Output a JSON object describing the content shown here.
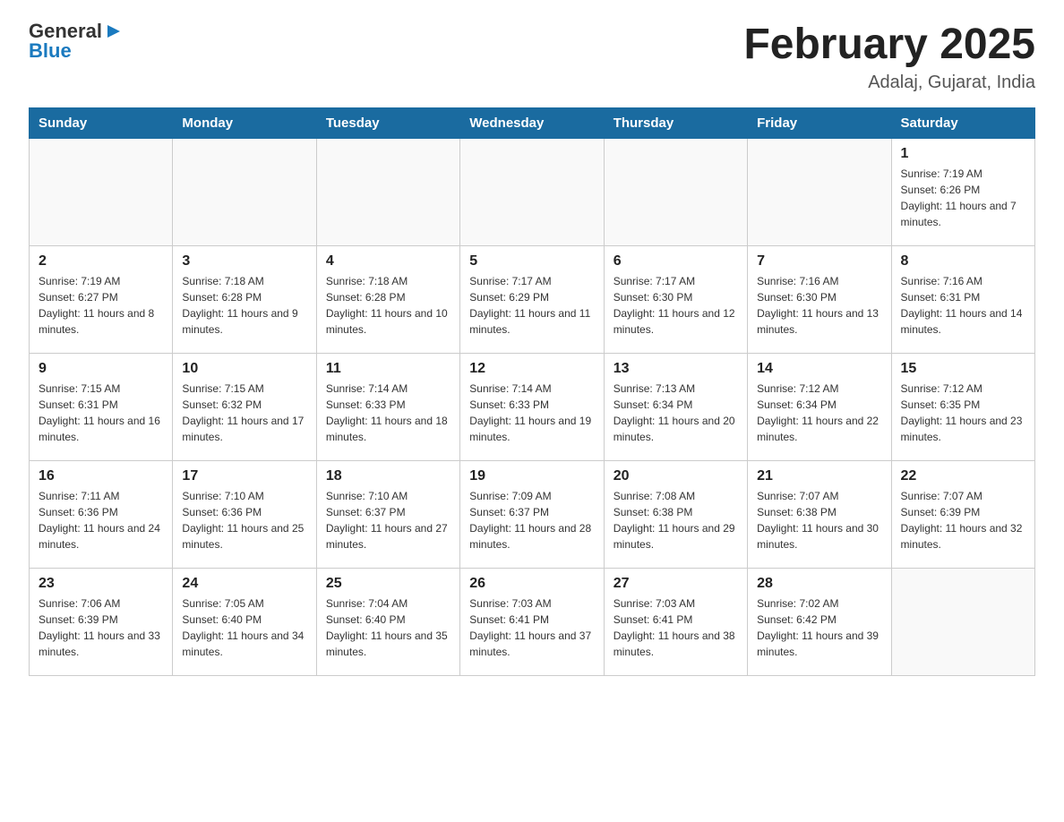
{
  "logo": {
    "text_general": "General",
    "text_blue": "Blue",
    "triangle": "▶"
  },
  "title": "February 2025",
  "subtitle": "Adalaj, Gujarat, India",
  "days_of_week": [
    "Sunday",
    "Monday",
    "Tuesday",
    "Wednesday",
    "Thursday",
    "Friday",
    "Saturday"
  ],
  "weeks": [
    [
      {
        "day": "",
        "sunrise": "",
        "sunset": "",
        "daylight": ""
      },
      {
        "day": "",
        "sunrise": "",
        "sunset": "",
        "daylight": ""
      },
      {
        "day": "",
        "sunrise": "",
        "sunset": "",
        "daylight": ""
      },
      {
        "day": "",
        "sunrise": "",
        "sunset": "",
        "daylight": ""
      },
      {
        "day": "",
        "sunrise": "",
        "sunset": "",
        "daylight": ""
      },
      {
        "day": "",
        "sunrise": "",
        "sunset": "",
        "daylight": ""
      },
      {
        "day": "1",
        "sunrise": "Sunrise: 7:19 AM",
        "sunset": "Sunset: 6:26 PM",
        "daylight": "Daylight: 11 hours and 7 minutes."
      }
    ],
    [
      {
        "day": "2",
        "sunrise": "Sunrise: 7:19 AM",
        "sunset": "Sunset: 6:27 PM",
        "daylight": "Daylight: 11 hours and 8 minutes."
      },
      {
        "day": "3",
        "sunrise": "Sunrise: 7:18 AM",
        "sunset": "Sunset: 6:28 PM",
        "daylight": "Daylight: 11 hours and 9 minutes."
      },
      {
        "day": "4",
        "sunrise": "Sunrise: 7:18 AM",
        "sunset": "Sunset: 6:28 PM",
        "daylight": "Daylight: 11 hours and 10 minutes."
      },
      {
        "day": "5",
        "sunrise": "Sunrise: 7:17 AM",
        "sunset": "Sunset: 6:29 PM",
        "daylight": "Daylight: 11 hours and 11 minutes."
      },
      {
        "day": "6",
        "sunrise": "Sunrise: 7:17 AM",
        "sunset": "Sunset: 6:30 PM",
        "daylight": "Daylight: 11 hours and 12 minutes."
      },
      {
        "day": "7",
        "sunrise": "Sunrise: 7:16 AM",
        "sunset": "Sunset: 6:30 PM",
        "daylight": "Daylight: 11 hours and 13 minutes."
      },
      {
        "day": "8",
        "sunrise": "Sunrise: 7:16 AM",
        "sunset": "Sunset: 6:31 PM",
        "daylight": "Daylight: 11 hours and 14 minutes."
      }
    ],
    [
      {
        "day": "9",
        "sunrise": "Sunrise: 7:15 AM",
        "sunset": "Sunset: 6:31 PM",
        "daylight": "Daylight: 11 hours and 16 minutes."
      },
      {
        "day": "10",
        "sunrise": "Sunrise: 7:15 AM",
        "sunset": "Sunset: 6:32 PM",
        "daylight": "Daylight: 11 hours and 17 minutes."
      },
      {
        "day": "11",
        "sunrise": "Sunrise: 7:14 AM",
        "sunset": "Sunset: 6:33 PM",
        "daylight": "Daylight: 11 hours and 18 minutes."
      },
      {
        "day": "12",
        "sunrise": "Sunrise: 7:14 AM",
        "sunset": "Sunset: 6:33 PM",
        "daylight": "Daylight: 11 hours and 19 minutes."
      },
      {
        "day": "13",
        "sunrise": "Sunrise: 7:13 AM",
        "sunset": "Sunset: 6:34 PM",
        "daylight": "Daylight: 11 hours and 20 minutes."
      },
      {
        "day": "14",
        "sunrise": "Sunrise: 7:12 AM",
        "sunset": "Sunset: 6:34 PM",
        "daylight": "Daylight: 11 hours and 22 minutes."
      },
      {
        "day": "15",
        "sunrise": "Sunrise: 7:12 AM",
        "sunset": "Sunset: 6:35 PM",
        "daylight": "Daylight: 11 hours and 23 minutes."
      }
    ],
    [
      {
        "day": "16",
        "sunrise": "Sunrise: 7:11 AM",
        "sunset": "Sunset: 6:36 PM",
        "daylight": "Daylight: 11 hours and 24 minutes."
      },
      {
        "day": "17",
        "sunrise": "Sunrise: 7:10 AM",
        "sunset": "Sunset: 6:36 PM",
        "daylight": "Daylight: 11 hours and 25 minutes."
      },
      {
        "day": "18",
        "sunrise": "Sunrise: 7:10 AM",
        "sunset": "Sunset: 6:37 PM",
        "daylight": "Daylight: 11 hours and 27 minutes."
      },
      {
        "day": "19",
        "sunrise": "Sunrise: 7:09 AM",
        "sunset": "Sunset: 6:37 PM",
        "daylight": "Daylight: 11 hours and 28 minutes."
      },
      {
        "day": "20",
        "sunrise": "Sunrise: 7:08 AM",
        "sunset": "Sunset: 6:38 PM",
        "daylight": "Daylight: 11 hours and 29 minutes."
      },
      {
        "day": "21",
        "sunrise": "Sunrise: 7:07 AM",
        "sunset": "Sunset: 6:38 PM",
        "daylight": "Daylight: 11 hours and 30 minutes."
      },
      {
        "day": "22",
        "sunrise": "Sunrise: 7:07 AM",
        "sunset": "Sunset: 6:39 PM",
        "daylight": "Daylight: 11 hours and 32 minutes."
      }
    ],
    [
      {
        "day": "23",
        "sunrise": "Sunrise: 7:06 AM",
        "sunset": "Sunset: 6:39 PM",
        "daylight": "Daylight: 11 hours and 33 minutes."
      },
      {
        "day": "24",
        "sunrise": "Sunrise: 7:05 AM",
        "sunset": "Sunset: 6:40 PM",
        "daylight": "Daylight: 11 hours and 34 minutes."
      },
      {
        "day": "25",
        "sunrise": "Sunrise: 7:04 AM",
        "sunset": "Sunset: 6:40 PM",
        "daylight": "Daylight: 11 hours and 35 minutes."
      },
      {
        "day": "26",
        "sunrise": "Sunrise: 7:03 AM",
        "sunset": "Sunset: 6:41 PM",
        "daylight": "Daylight: 11 hours and 37 minutes."
      },
      {
        "day": "27",
        "sunrise": "Sunrise: 7:03 AM",
        "sunset": "Sunset: 6:41 PM",
        "daylight": "Daylight: 11 hours and 38 minutes."
      },
      {
        "day": "28",
        "sunrise": "Sunrise: 7:02 AM",
        "sunset": "Sunset: 6:42 PM",
        "daylight": "Daylight: 11 hours and 39 minutes."
      },
      {
        "day": "",
        "sunrise": "",
        "sunset": "",
        "daylight": ""
      }
    ]
  ]
}
